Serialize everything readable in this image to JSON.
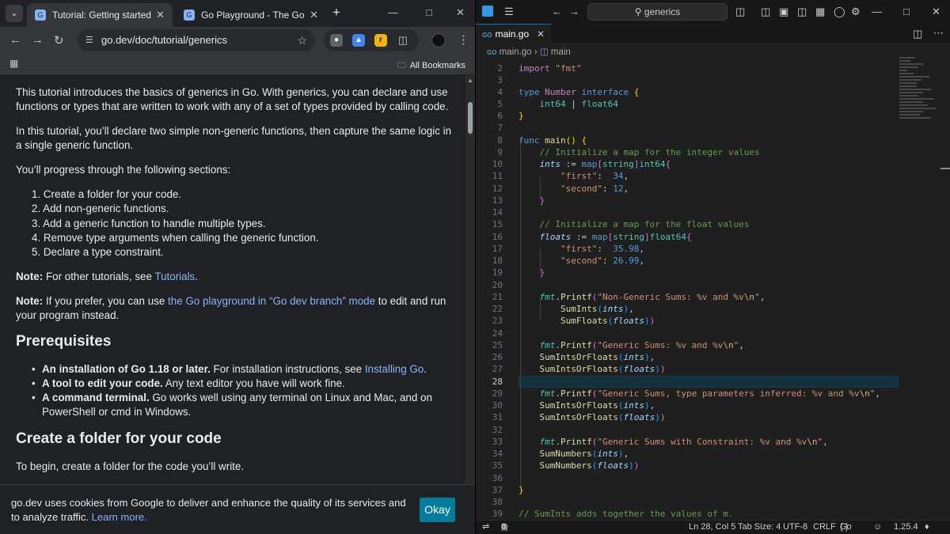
{
  "browser": {
    "tabs": [
      {
        "title": "Tutorial: Getting started with generics",
        "active": true
      },
      {
        "title": "Go Playground - The Go Programming Language",
        "active": false
      }
    ],
    "new_tab_label": "+",
    "url": "go.dev/doc/tutorial/generics",
    "bookmarks_label": "All Bookmarks",
    "page": {
      "intro": "This tutorial introduces the basics of generics in Go. With generics, you can declare and use functions or types that are written to work with any of a set of types provided by calling code.",
      "p2": "In this tutorial, you’ll declare two simple non-generic functions, then capture the same logic in a single generic function.",
      "p3": "You’ll progress through the following sections:",
      "sections": [
        "Create a folder for your code.",
        "Add non-generic functions.",
        "Add a generic function to handle multiple types.",
        "Remove type arguments when calling the generic function.",
        "Declare a type constraint."
      ],
      "note_label": "Note:",
      "note1_text": " For other tutorials, see ",
      "note1_link": "Tutorials",
      "note1_end": ".",
      "note2_text": " If you prefer, you can use ",
      "note2_link": "the Go playground in “Go dev branch” mode",
      "note2_end": " to edit and run your program instead.",
      "prereq_heading": "Prerequisites",
      "prereqs": [
        {
          "bold": "An installation of Go 1.18 or later.",
          "text": " For installation instructions, see ",
          "link": "Installing Go",
          "end": "."
        },
        {
          "bold": "A tool to edit your code.",
          "text": " Any text editor you have will work fine.",
          "link": "",
          "end": ""
        },
        {
          "bold": "A command terminal.",
          "text": " Go works well using any terminal on Linux and Mac, and on PowerShell or cmd in Windows.",
          "link": "",
          "end": ""
        }
      ],
      "folder_heading": "Create a folder for your code",
      "folder_text": "To begin, create a folder for the code you’ll write."
    },
    "cookie": {
      "message": "go.dev uses cookies from Google to deliver and enhance the quality of its services and to analyze traffic. ",
      "learn_more": "Learn more.",
      "okay": "Okay"
    }
  },
  "vscode": {
    "search_placeholder": "generics",
    "tab_title": "main.go",
    "breadcrumb_file": "main.go",
    "breadcrumb_symbol": "main",
    "current_line": 28,
    "status": {
      "errors": "0",
      "warnings": "0",
      "position": "Ln 28, Col 5",
      "tab_size": "Tab Size: 4",
      "encoding": "UTF-8",
      "eol": "CRLF",
      "language": "Go",
      "version": "1.25.4"
    }
  }
}
